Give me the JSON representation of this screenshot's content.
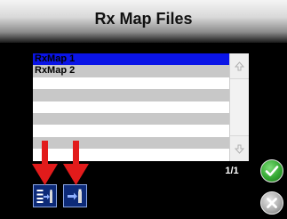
{
  "header": {
    "title": "Rx Map Files"
  },
  "file_list": {
    "items": [
      {
        "label": "RxMap 1",
        "selected": true
      },
      {
        "label": "RxMap 2",
        "selected": false
      },
      {
        "label": "",
        "selected": false
      },
      {
        "label": "",
        "selected": false
      },
      {
        "label": "",
        "selected": false
      },
      {
        "label": "",
        "selected": false
      },
      {
        "label": "",
        "selected": false
      },
      {
        "label": "",
        "selected": false
      },
      {
        "label": "",
        "selected": false
      }
    ],
    "selected_color": "#0a14e6",
    "stripe_color": "#c8c8c8"
  },
  "scrollbar": {
    "up_icon": "arrow-up-icon",
    "down_icon": "arrow-down-icon"
  },
  "pagination": {
    "page_text": "1/1"
  },
  "actions": {
    "ok_icon": "checkmark-icon",
    "cancel_icon": "x-icon",
    "tool_1_icon": "import-list-icon",
    "tool_2_icon": "import-file-icon"
  },
  "annotations": {
    "arrow_color": "#e21b1b"
  }
}
